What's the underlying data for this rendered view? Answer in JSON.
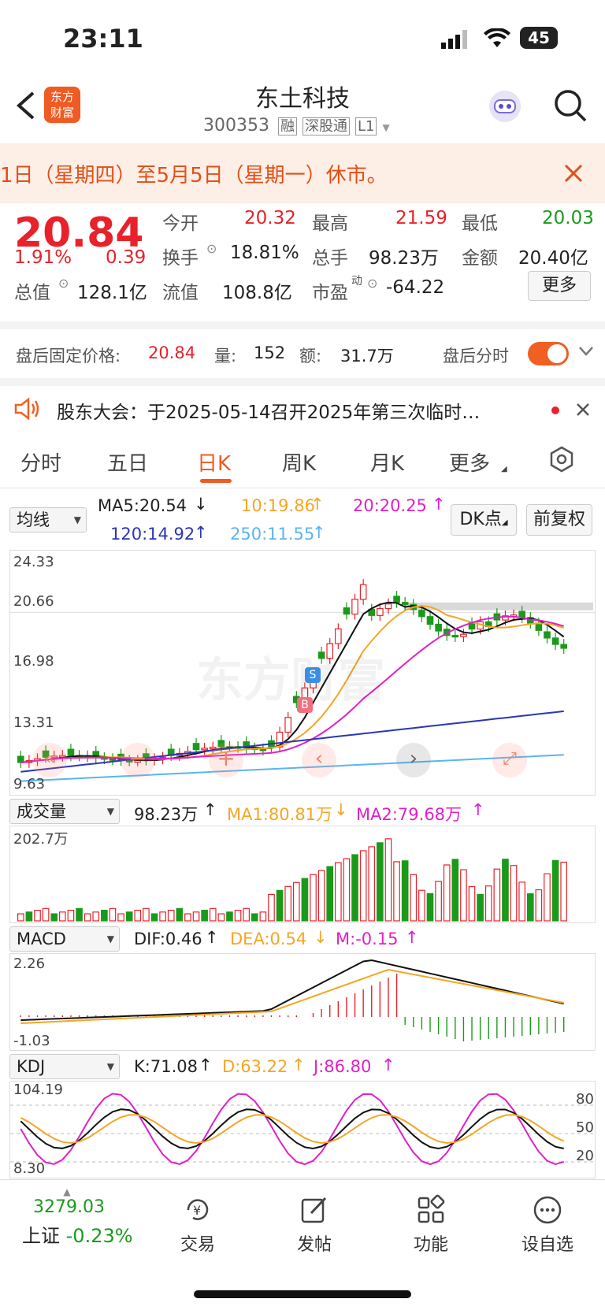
{
  "status": {
    "time": "23:11",
    "battery": "45"
  },
  "header": {
    "title": "东土科技",
    "code": "300353",
    "badges": [
      "融",
      "深股通",
      "L1"
    ],
    "logo_top": "东方",
    "logo_bottom": "财富"
  },
  "notice": {
    "text": "1日（星期四）至5月5日（星期一）休市。"
  },
  "quote": {
    "price": "20.84",
    "pct": "1.91%",
    "chg": "0.39",
    "open_label": "今开",
    "open": "20.32",
    "high_label": "最高",
    "high": "21.59",
    "low_label": "最低",
    "low": "20.03",
    "turnover_label": "换手",
    "turnover": "18.81%",
    "volume_label": "总手",
    "volume": "98.23万",
    "amount_label": "金额",
    "amount": "20.40亿",
    "mktcap_label": "总值",
    "mktcap": "128.1亿",
    "float_label": "流值",
    "float": "108.8亿",
    "pe_label": "市盈",
    "pe_sup": "动",
    "pe": "-64.22",
    "more": "更多"
  },
  "afterhours": {
    "label": "盘后固定价格:",
    "price": "20.84",
    "vol_label": "量:",
    "vol": "152",
    "amt_label": "额:",
    "amt": "31.7万",
    "toggle_label": "盘后分时"
  },
  "announce": {
    "text": "股东大会：于2025-05-14召开2025年第三次临时…"
  },
  "tabs": [
    "分时",
    "五日",
    "日K",
    "周K",
    "月K",
    "更多"
  ],
  "active_tab": "日K",
  "ma": {
    "selector": "均线",
    "ma5": "MA5:20.54",
    "ma10": "10:19.86",
    "ma20": "20:20.25",
    "ma120": "120:14.92",
    "ma250": "250:11.55",
    "dk": "DK点",
    "adjust": "前复权"
  },
  "kchart": {
    "y_labels": [
      "24.33",
      "20.66",
      "16.98",
      "13.31",
      "9.63"
    ],
    "watermark": "东方财富",
    "markers": [
      "S",
      "B"
    ]
  },
  "vol_panel": {
    "selector": "成交量",
    "value": "98.23万",
    "ma1": "MA1:80.81万",
    "ma2": "MA2:79.68万",
    "ymax": "202.7万"
  },
  "macd_panel": {
    "selector": "MACD",
    "dif": "DIF:0.46",
    "dea": "DEA:0.54",
    "m": "M:-0.15",
    "ymax": "2.26",
    "ymin": "-1.03"
  },
  "kdj_panel": {
    "selector": "KDJ",
    "k": "K:71.08",
    "d": "D:63.22",
    "j": "J:86.80",
    "ymax": "104.19",
    "ymin": "8.30",
    "levels": [
      "80",
      "50",
      "20"
    ]
  },
  "bottom": {
    "index_value": "3279.03",
    "index_name": "上证",
    "index_pct": "-0.23%",
    "nav": [
      "交易",
      "发帖",
      "功能",
      "设自选"
    ]
  },
  "colors": {
    "up": "#e8212a",
    "down": "#1a9a1a",
    "ma10": "#f5a623",
    "ma20": "#e020c8",
    "ma120": "#2b35b8",
    "ma250": "#5ab4f0"
  }
}
